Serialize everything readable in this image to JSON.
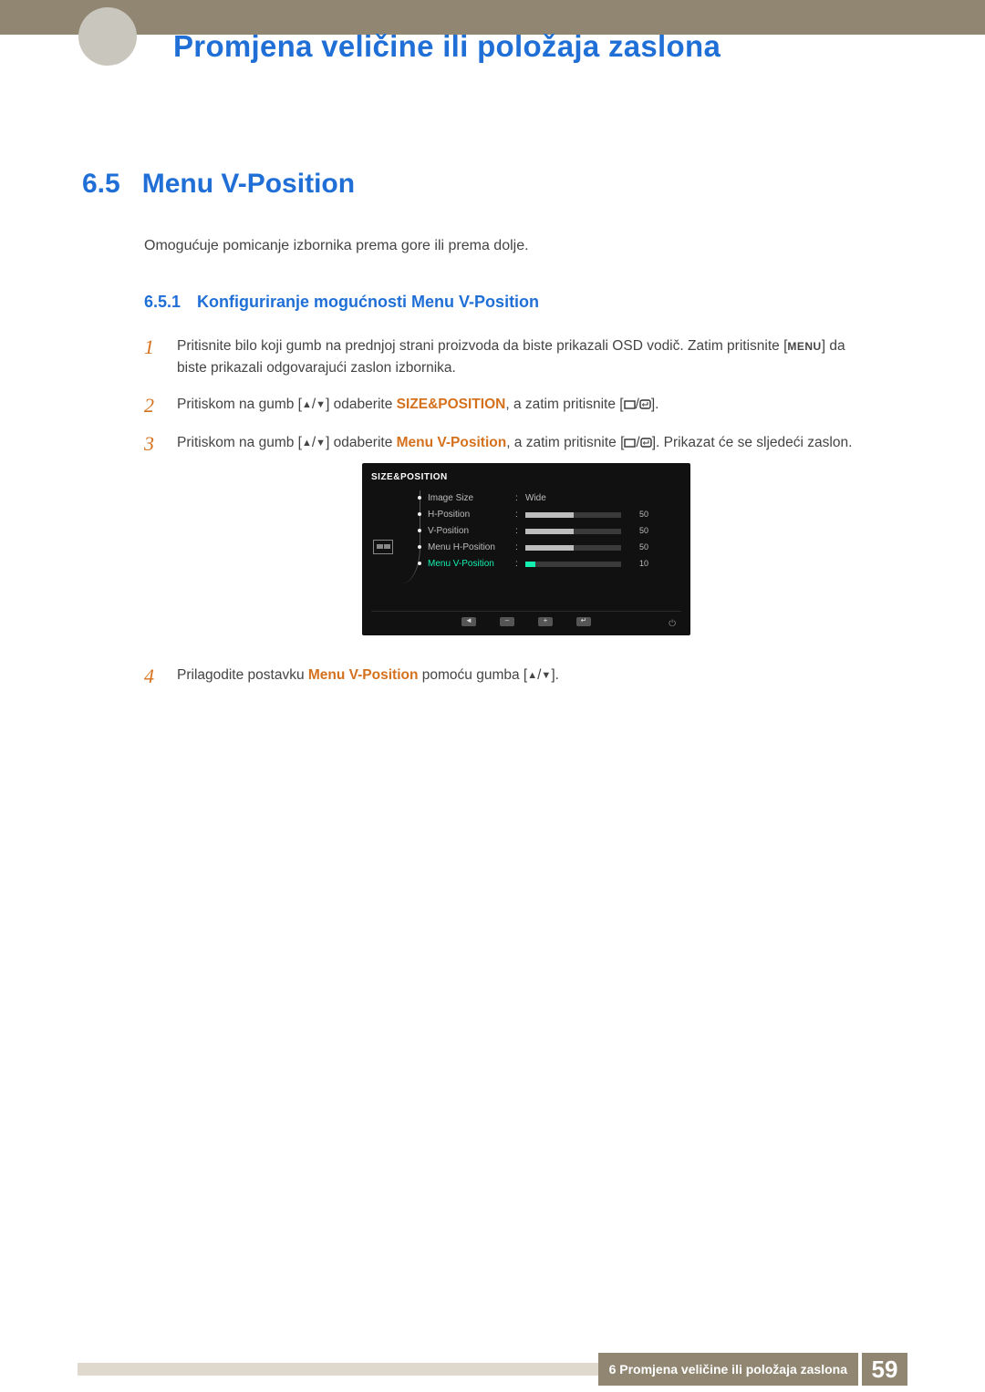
{
  "chapter_title": "Promjena veličine ili položaja zaslona",
  "section": {
    "number": "6.5",
    "title": "Menu V-Position"
  },
  "intro": "Omogućuje pomicanje izbornika prema gore ili prema dolje.",
  "subsection": {
    "number": "6.5.1",
    "title": "Konfiguriranje mogućnosti Menu V-Position"
  },
  "steps": {
    "s1": {
      "num": "1",
      "t1": "Pritisnite bilo koji gumb na prednjoj strani proizvoda da biste prikazali OSD vodič. Zatim pritisnite [",
      "menu": "MENU",
      "t2": "] da biste prikazali odgovarajući zaslon izbornika."
    },
    "s2": {
      "num": "2",
      "t1": "Pritiskom na gumb [",
      "t2": "] odaberite ",
      "hl": "SIZE&POSITION",
      "t3": ", a zatim pritisnite [",
      "t4": "]."
    },
    "s3": {
      "num": "3",
      "t1": "Pritiskom na gumb [",
      "t2": "] odaberite ",
      "hl": "Menu V-Position",
      "t3": ", a zatim pritisnite [",
      "t4": "]. Prikazat će se sljedeći zaslon."
    },
    "s4": {
      "num": "4",
      "t1": "Prilagodite postavku ",
      "hl": "Menu V-Position",
      "t2": " pomoću gumba [",
      "t3": "]."
    }
  },
  "osd": {
    "title": "SIZE&POSITION",
    "rows": [
      {
        "label": "Image Size",
        "value_text": "Wide"
      },
      {
        "label": "H-Position",
        "bar": 50,
        "num": "50"
      },
      {
        "label": "V-Position",
        "bar": 50,
        "num": "50"
      },
      {
        "label": "Menu H-Position",
        "bar": 50,
        "num": "50"
      },
      {
        "label": "Menu V-Position",
        "bar": 10,
        "num": "10",
        "active": true
      }
    ]
  },
  "footer": {
    "chapter_label": "6 Promjena veličine ili položaja zaslona",
    "page": "59"
  },
  "glyphs": {
    "up": "▲",
    "down": "▼",
    "slash": "/",
    "power": "⏻",
    "left": "◄",
    "minus": "–",
    "plus": "+",
    "ret": "↵"
  }
}
